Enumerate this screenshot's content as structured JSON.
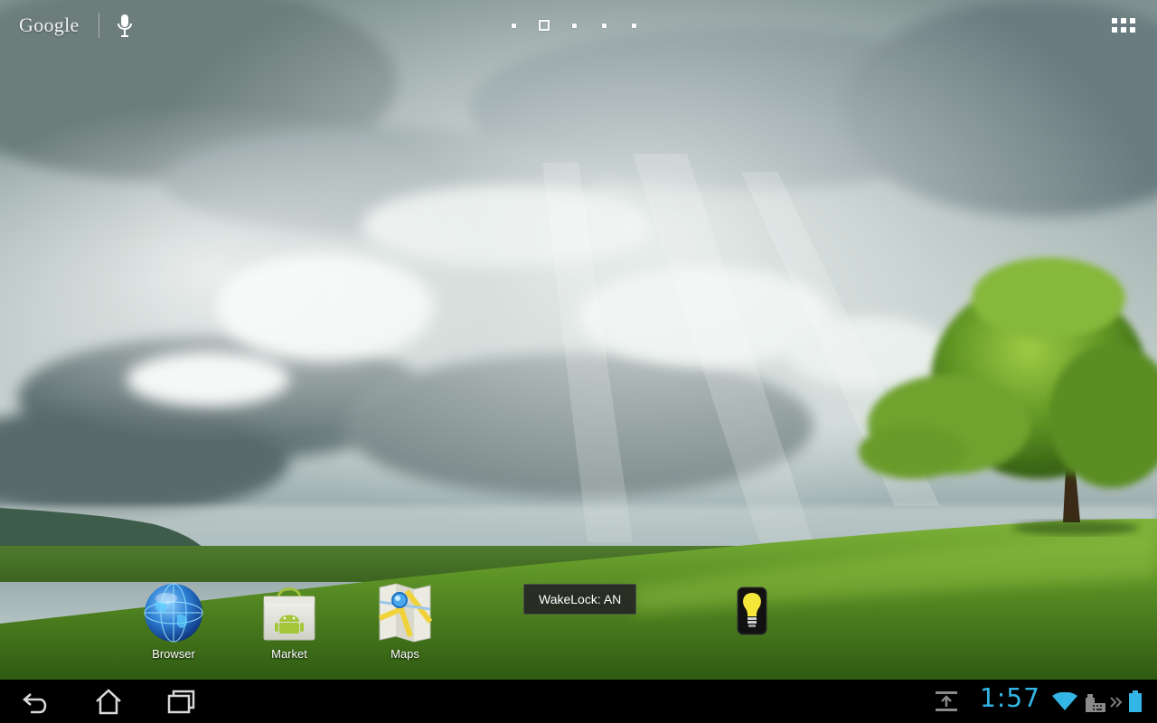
{
  "search_bar": {
    "logo_text": "Google"
  },
  "home_pages": {
    "count": 5,
    "current_index": 1
  },
  "shortcuts": [
    {
      "label": "Browser",
      "icon": "globe-icon"
    },
    {
      "label": "Market",
      "icon": "shopping-bag-icon"
    },
    {
      "label": "Maps",
      "icon": "map-icon"
    }
  ],
  "widget": {
    "icon": "light-bulb-icon"
  },
  "toast": {
    "text": "WakeLock: AN"
  },
  "system_bar": {
    "clock": "1:57",
    "clock_color": "#33b5e5",
    "icons": [
      "back-icon",
      "home-icon",
      "recent-apps-icon",
      "download-icon",
      "wifi-icon",
      "keyboard-icon",
      "chevron-right-icon",
      "battery-icon"
    ]
  },
  "colors": {
    "accent": "#33b5e5",
    "system_bar_bg": "#000000"
  }
}
